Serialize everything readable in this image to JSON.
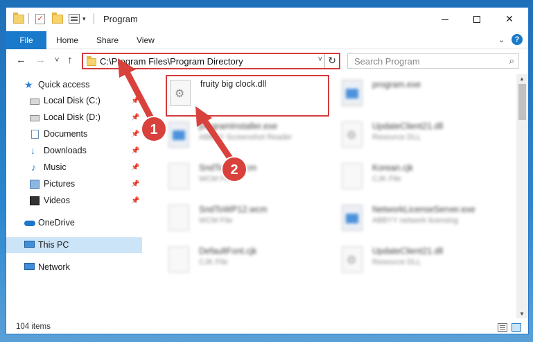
{
  "window": {
    "title": "Program",
    "controls": {
      "minimize": "minimize",
      "maximize": "maximize",
      "close": "✕"
    }
  },
  "ribbon": {
    "tabs": [
      "File",
      "Home",
      "Share",
      "View"
    ],
    "expand_glyph": "⌄",
    "help_glyph": "?"
  },
  "navigation": {
    "back_glyph": "←",
    "forward_glyph": "→",
    "recent_glyph": "˅",
    "up_glyph": "↑",
    "address": "C:\\Program Files\\Program Directory",
    "address_dropdown_glyph": "˅",
    "refresh_glyph": "↻",
    "search_placeholder": "Search Program",
    "search_glyph": "⌕"
  },
  "sidebar": {
    "items": [
      {
        "label": "Quick access",
        "icon": "star-icon",
        "pinned": false
      },
      {
        "label": "Local Disk (C:)",
        "icon": "disk-icon",
        "pinned": true
      },
      {
        "label": "Local Disk (D:)",
        "icon": "disk-icon",
        "pinned": true
      },
      {
        "label": "Documents",
        "icon": "documents-icon",
        "pinned": true
      },
      {
        "label": "Downloads",
        "icon": "downloads-icon",
        "pinned": true
      },
      {
        "label": "Music",
        "icon": "music-icon",
        "pinned": true
      },
      {
        "label": "Pictures",
        "icon": "pictures-icon",
        "pinned": true
      },
      {
        "label": "Videos",
        "icon": "videos-icon",
        "pinned": true
      },
      {
        "label": "OneDrive",
        "icon": "onedrive-icon",
        "pinned": false
      },
      {
        "label": "This PC",
        "icon": "this-pc-icon",
        "pinned": false,
        "selected": true
      },
      {
        "label": "Network",
        "icon": "network-icon",
        "pinned": false
      }
    ],
    "pin_glyph": "📌"
  },
  "files": [
    {
      "name": "fruity big clock.dll",
      "subtitle": "",
      "icon": "dll-gear-icon",
      "highlighted": true
    },
    {
      "name": "program.exe",
      "subtitle": "",
      "icon": "exe-icon",
      "blurred": true
    },
    {
      "name": "programInstaller.exe",
      "subtitle": "ABBYY Screenshot Reader",
      "icon": "exe-icon",
      "blurred": true
    },
    {
      "name": "UpdateClient21.dll",
      "subtitle": "Resource DLL",
      "icon": "dll-gear-icon",
      "blurred": true
    },
    {
      "name": "SndToWP.wcm",
      "subtitle": "WCM File",
      "icon": "file-icon",
      "blurred": true
    },
    {
      "name": "Korean.cjk",
      "subtitle": "CJK File",
      "icon": "file-icon",
      "blurred": true
    },
    {
      "name": "SndToWP12.wcm",
      "subtitle": "WCM File",
      "icon": "file-icon",
      "blurred": true
    },
    {
      "name": "NetworkLicenseServer.exe",
      "subtitle": "ABBYY network licensing",
      "icon": "exe-icon",
      "blurred": true
    },
    {
      "name": "DefaultFont.cjk",
      "subtitle": "CJK File",
      "icon": "file-icon",
      "blurred": true
    },
    {
      "name": "UpdateClient21.dll",
      "subtitle": "Resource DLL",
      "icon": "dll-gear-icon",
      "blurred": true
    }
  ],
  "status": {
    "item_count": "104 items"
  },
  "annotations": {
    "marker_1": "1",
    "marker_2": "2",
    "color": "#d9413c"
  }
}
